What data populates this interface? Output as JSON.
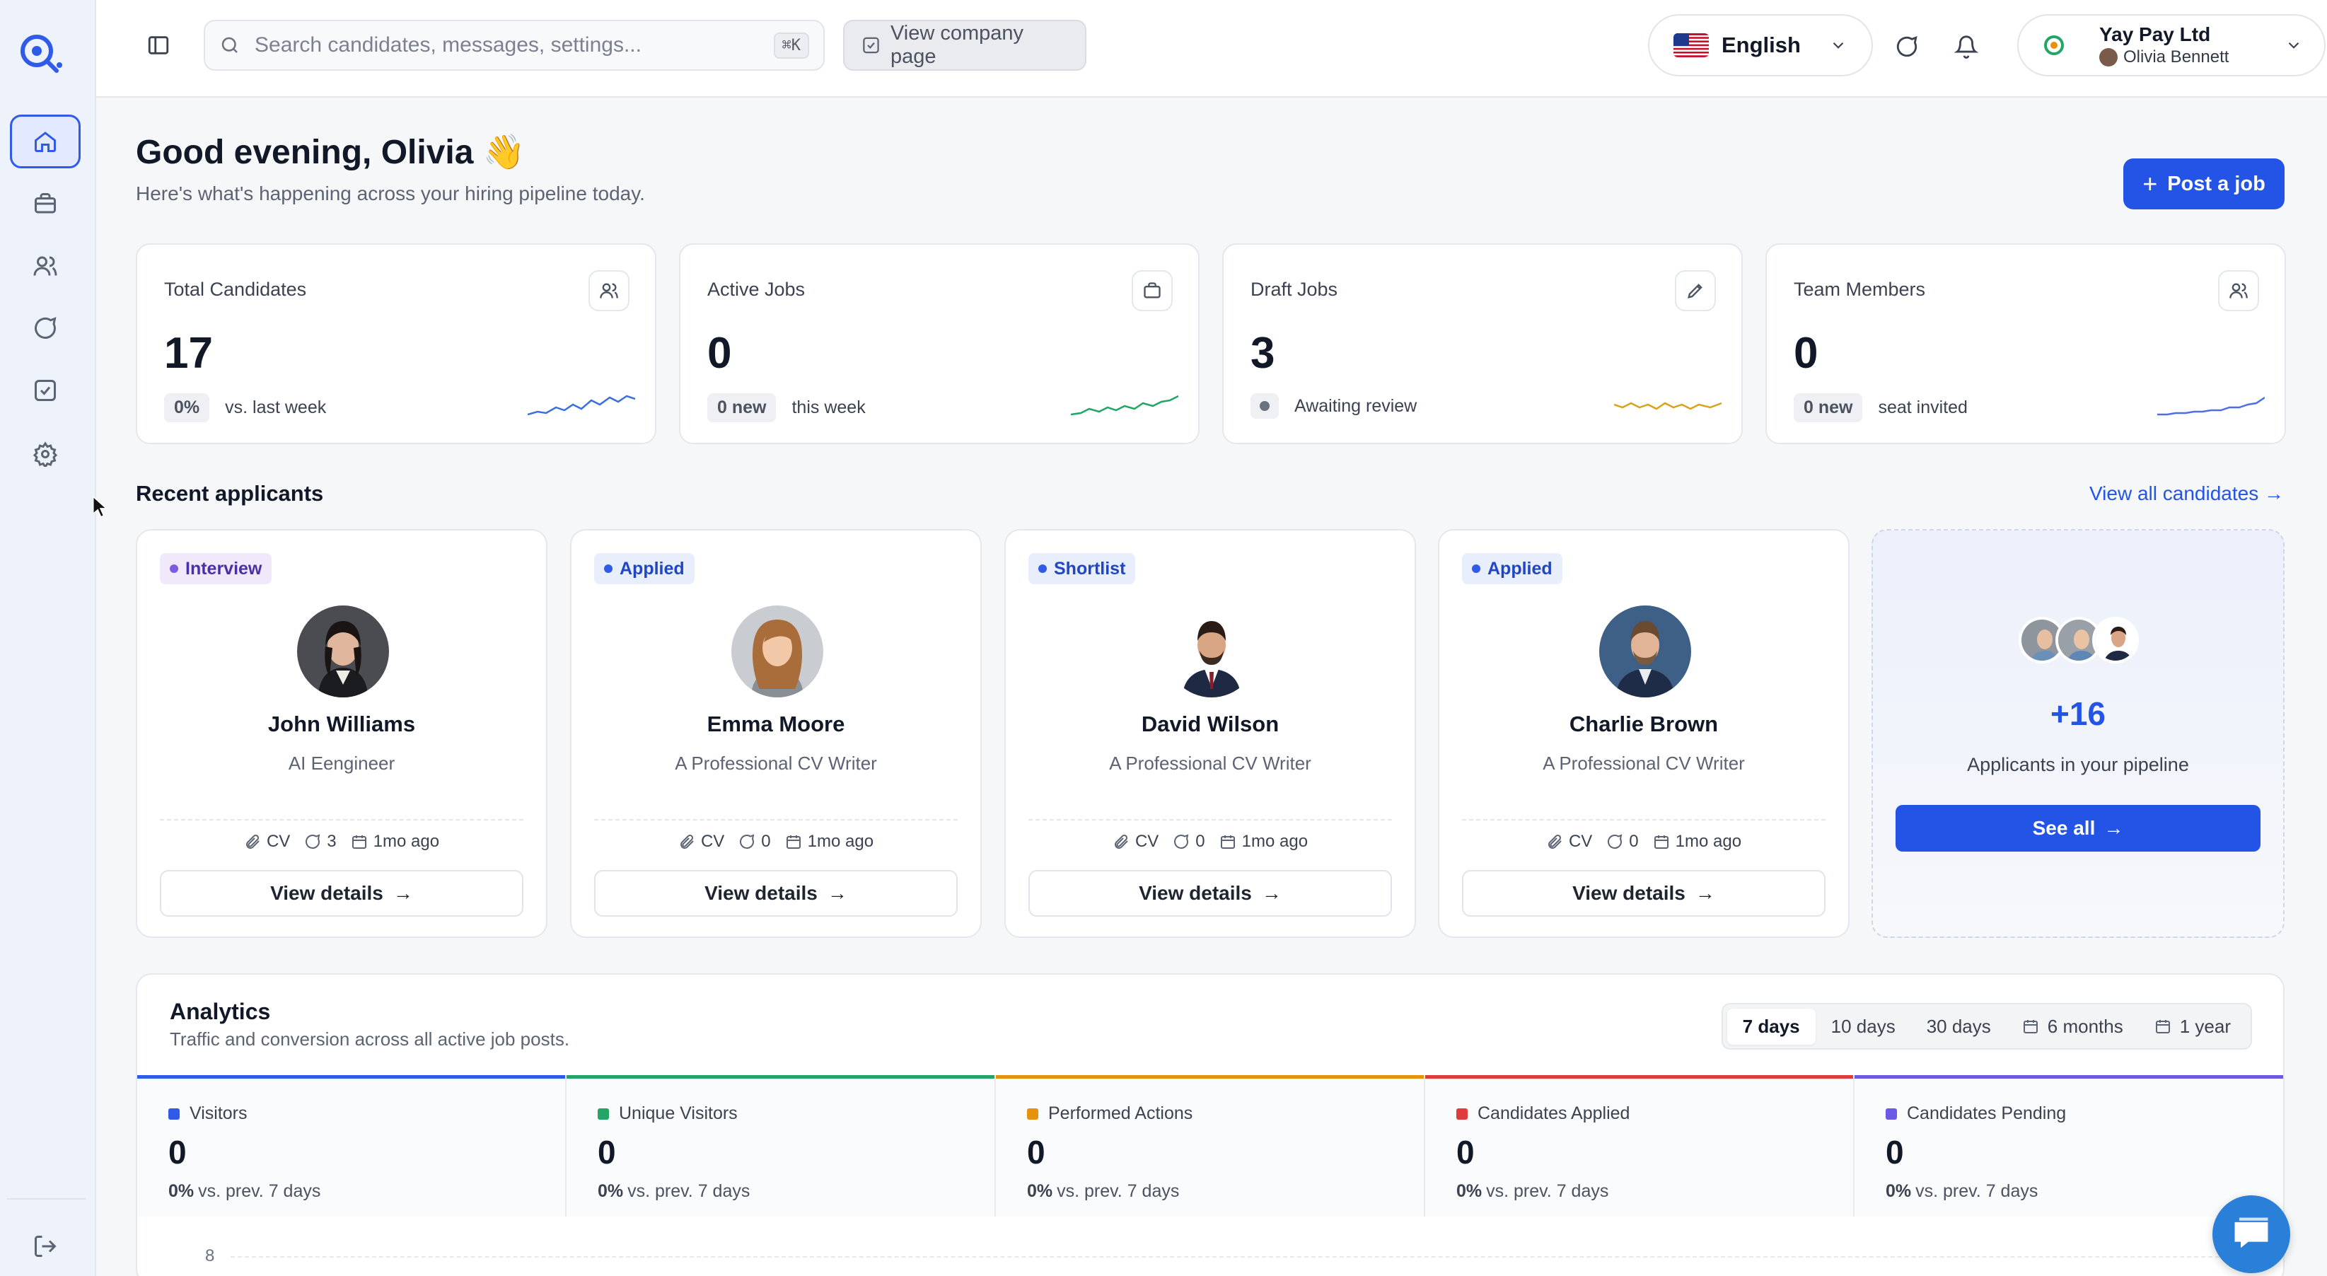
{
  "colors": {
    "primary": "#2454e6",
    "visitors": "#2f5be8",
    "unique_visitors": "#22a565",
    "performed_actions": "#e8920c",
    "candidates_applied": "#e23b3b",
    "candidates_pending": "#6b58e6"
  },
  "sidebar": {
    "items": [
      {
        "icon": "home-icon",
        "active": true
      },
      {
        "icon": "briefcase-icon"
      },
      {
        "icon": "users-icon"
      },
      {
        "icon": "message-icon"
      },
      {
        "icon": "checkbox-icon"
      },
      {
        "icon": "gear-icon"
      }
    ],
    "bottom_icon": "logout-icon"
  },
  "topbar": {
    "search_placeholder": "Search candidates, messages, settings...",
    "search_shortcut": "⌘K",
    "view_company_label": "View company page",
    "language": "English",
    "company": "Yay Pay Ltd",
    "user": "Olivia Bennett"
  },
  "header": {
    "greeting": "Good evening, Olivia 👋",
    "subtitle": "Here's what's happening across your hiring pipeline today.",
    "post_job_label": "Post a job"
  },
  "stats": [
    {
      "title": "Total Candidates",
      "value": "17",
      "pill": "0%",
      "note": "vs. last week",
      "icon": "users-icon",
      "spark_color": "#3b6fe0"
    },
    {
      "title": "Active Jobs",
      "value": "0",
      "pill": "0 new",
      "note": "this week",
      "icon": "briefcase-icon",
      "spark_color": "#22a565"
    },
    {
      "title": "Draft Jobs",
      "value": "3",
      "pill": "",
      "note": "Awaiting review",
      "icon": "pen-icon",
      "spark_color": "#d9a21b"
    },
    {
      "title": "Team Members",
      "value": "0",
      "pill": "0 new",
      "note": "seat invited",
      "icon": "users-icon",
      "spark_color": "#4c6fe6"
    }
  ],
  "recent": {
    "title": "Recent applicants",
    "view_all": "View all candidates →",
    "applicants": [
      {
        "status": "Interview",
        "name": "John Williams",
        "role": "AI Eengineer",
        "cv": "CV",
        "comments": "3",
        "time": "1mo ago",
        "action": "View details"
      },
      {
        "status": "Applied",
        "name": "Emma Moore",
        "role": "A Professional CV Writer",
        "cv": "CV",
        "comments": "0",
        "time": "1mo ago",
        "action": "View details"
      },
      {
        "status": "Shortlist",
        "name": "David Wilson",
        "role": "A Professional CV Writer",
        "cv": "CV",
        "comments": "0",
        "time": "1mo ago",
        "action": "View details"
      },
      {
        "status": "Applied",
        "name": "Charlie Brown",
        "role": "A Professional CV Writer",
        "cv": "CV",
        "comments": "0",
        "time": "1mo ago",
        "action": "View details"
      }
    ],
    "pipeline": {
      "count": "+16",
      "label": "Applicants in your pipeline",
      "button": "See all"
    }
  },
  "analytics": {
    "title": "Analytics",
    "subtitle": "Traffic and conversion across all active job posts.",
    "ranges": [
      "7 days",
      "10 days",
      "30 days",
      "6 months",
      "1 year"
    ],
    "active_range": "7 days",
    "metrics": [
      {
        "label": "Visitors",
        "value": "0",
        "change": "0%",
        "compare": "vs. prev. 7 days"
      },
      {
        "label": "Unique Visitors",
        "value": "0",
        "change": "0%",
        "compare": "vs. prev. 7 days"
      },
      {
        "label": "Performed Actions",
        "value": "0",
        "change": "0%",
        "compare": "vs. prev. 7 days"
      },
      {
        "label": "Candidates Applied",
        "value": "0",
        "change": "0%",
        "compare": "vs. prev. 7 days"
      },
      {
        "label": "Candidates Pending",
        "value": "0",
        "change": "0%",
        "compare": "vs. prev. 7 days"
      }
    ],
    "y_axis_tick": "8"
  }
}
